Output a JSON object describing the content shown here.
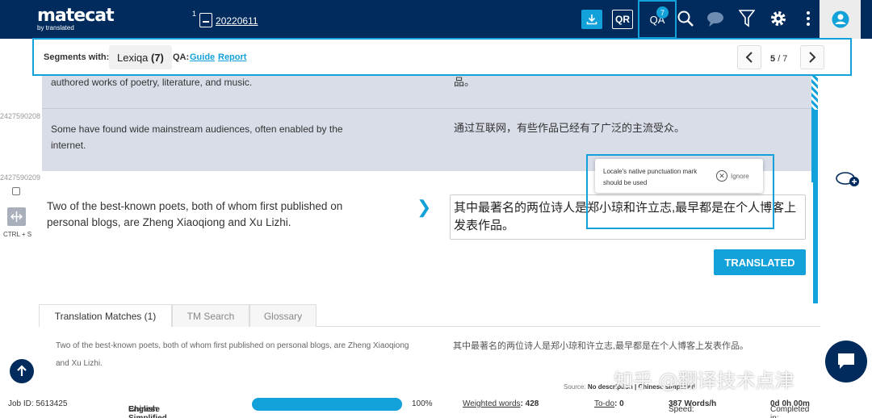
{
  "header": {
    "logo_text": "matecat",
    "logo_tagline": "by translated",
    "file_number": "1",
    "file_name": "20220611",
    "qr_label": "QR",
    "qa_label": "QA",
    "qa_badge": "7"
  },
  "qa_bar": {
    "segments_with_label": "Segments with:",
    "lexiqa_label": "Lexiqa",
    "lexiqa_count": "(7)",
    "qa_label": "QA:",
    "guide_link": "Guide",
    "report_link": "Report",
    "current": "5",
    "total": "/ 7"
  },
  "segments": {
    "prev_source_1": "authored works of poetry, literature, and music.",
    "prev_target_1": "品。",
    "prev_id_2": "2427590208",
    "prev_source_2": "Some have found wide mainstream audiences, often enabled by the internet.",
    "prev_target_2": "通过互联网，有些作品已经有了广泛的主流受众。",
    "active_id": "2427590209",
    "ctrl_label": "CTRL + S",
    "active_source": "Two of the best-known poets, both of whom first published on personal blogs, are Zheng Xiaoqiong and Xu Lizhi.",
    "active_target": "其中最著名的两位诗人是郑小琼和许立志,最早都是在个人博客上发表作品。",
    "translated_button": "TRANSLATED"
  },
  "tooltip": {
    "message": "Locale's native punctuation mark should be used",
    "ignore_label": "Ignore"
  },
  "tabs": [
    {
      "label": "Translation Matches (1)"
    },
    {
      "label": "TM Search"
    },
    {
      "label": "Glossary"
    }
  ],
  "match": {
    "source": "Two of the best-known poets, both of whom first published on personal blogs, are Zheng Xiaoqiong and Xu Lizhi.",
    "target": "其中最著名的两位诗人是郑小琼和许立志,最早都是在个人博客上发表作品。",
    "source_label": "Source:",
    "source_value": "No description | Chinese simplified"
  },
  "watermark": "知乎 @翻译技术点津",
  "footer": {
    "job_id": "Job ID: 5613425",
    "lang_from": "English",
    "lang_arrow": "→",
    "lang_to": "Chinese Simplified",
    "progress_percent": "100%",
    "weighted_label": "Weighted words",
    "weighted_value": ": 428",
    "todo_label": "To-do",
    "todo_value": ": 0",
    "speed_label": "Speed:",
    "speed_value": "387 Words/h",
    "completed_label": "Completed in:",
    "completed_value": "0d 0h 00m"
  },
  "colors": {
    "navy": "#002b5c",
    "accent": "#13a1d9",
    "segment_bg": "#d8dde8"
  }
}
